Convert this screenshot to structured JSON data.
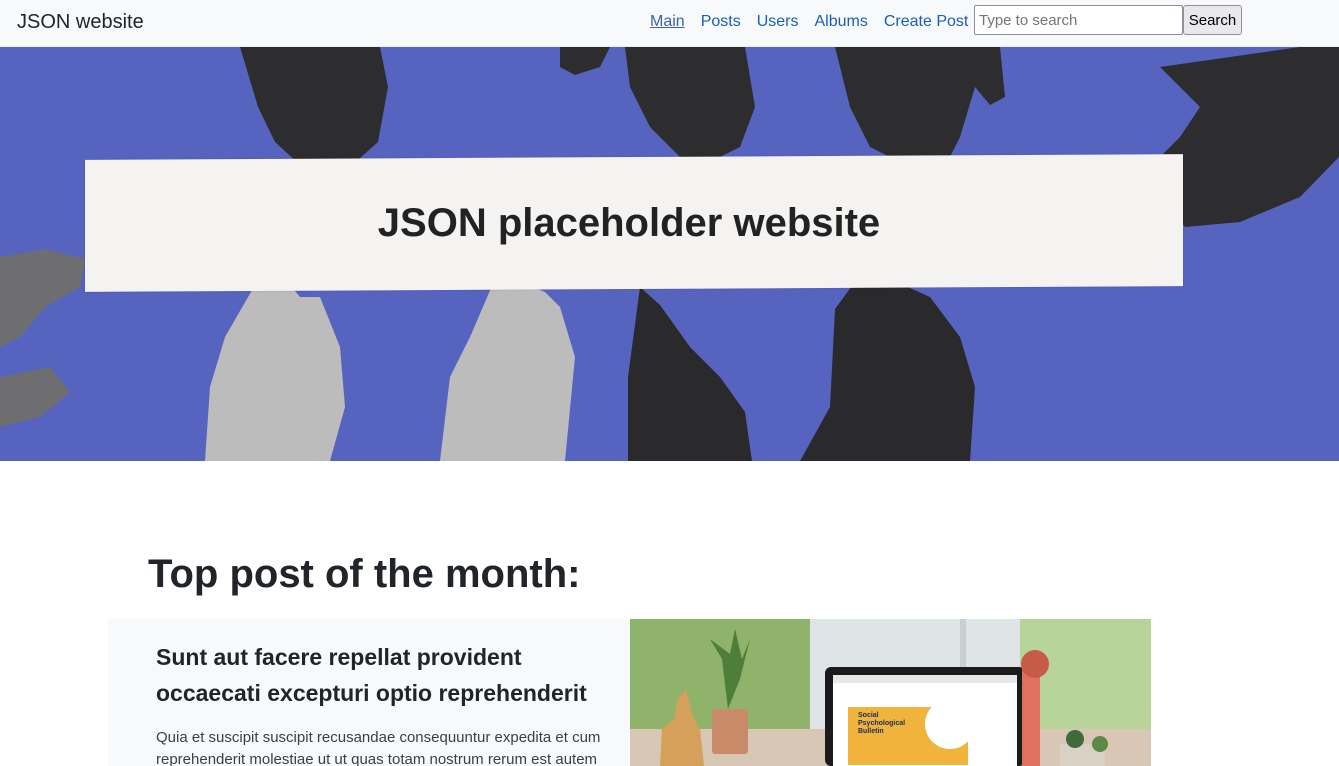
{
  "navbar": {
    "brand": "JSON website",
    "links": [
      {
        "label": "Main",
        "active": true
      },
      {
        "label": "Posts",
        "active": false
      },
      {
        "label": "Users",
        "active": false
      },
      {
        "label": "Albums",
        "active": false
      },
      {
        "label": "Create Post",
        "active": false
      }
    ],
    "search_placeholder": "Type to search",
    "search_value": "",
    "search_button": "Search"
  },
  "hero": {
    "title": "JSON placeholder website",
    "background_color": "#5664c0"
  },
  "section": {
    "title": "Top post of the month:"
  },
  "top_post": {
    "title": "Sunt aut facere repellat provident occaecati excepturi optio reprehenderit",
    "body": "Quia et suscipit suscipit recusandae consequuntur expedita et cum reprehenderit molestiae ut ut quas totam nostrum rerum est autem",
    "image_alt": "laptop-on-desk-image",
    "image_screen_text": [
      "Social",
      "Psychological",
      "Bulletin"
    ]
  }
}
